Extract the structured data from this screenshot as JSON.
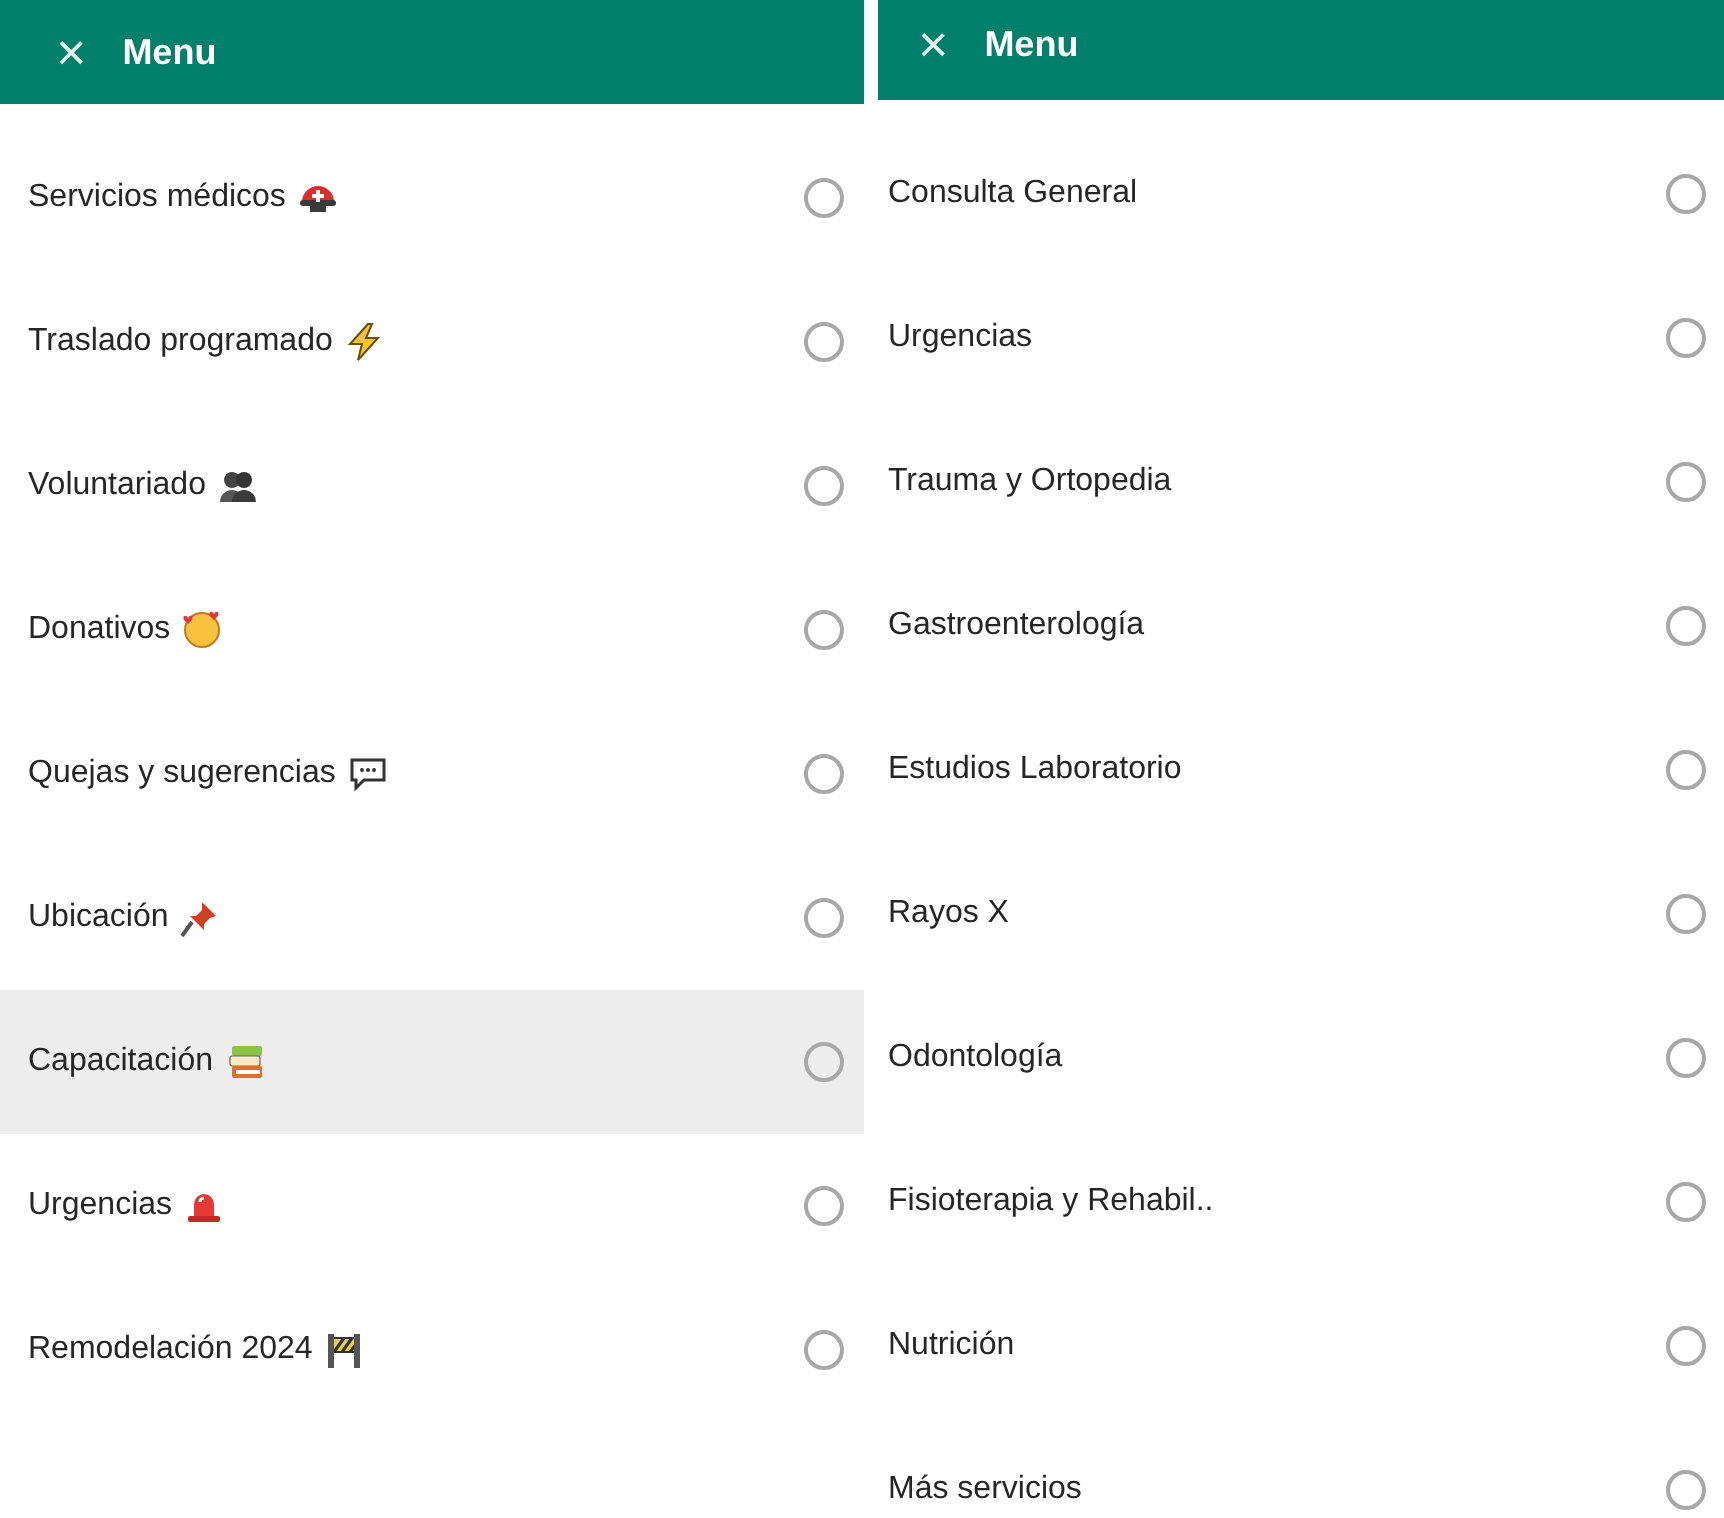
{
  "panels": [
    {
      "header": {
        "close": "×",
        "title": "Menu"
      },
      "items": [
        {
          "label": "Servicios médicos",
          "selected": false,
          "checked": false
        },
        {
          "label": "Traslado programado",
          "selected": false,
          "checked": false
        },
        {
          "label": "Voluntariado",
          "selected": false,
          "checked": false
        },
        {
          "label": "Donativos",
          "selected": false,
          "checked": false
        },
        {
          "label": "Quejas y sugerencias",
          "selected": false,
          "checked": false
        },
        {
          "label": "Ubicación",
          "selected": false,
          "checked": false
        },
        {
          "label": "Capacitación",
          "selected": true,
          "checked": false
        },
        {
          "label": "Urgencias",
          "selected": false,
          "checked": false
        },
        {
          "label": "Remodelación 2024",
          "selected": false,
          "checked": false
        }
      ]
    },
    {
      "header": {
        "close": "×",
        "title": "Menu"
      },
      "items": [
        {
          "label": "Consulta General",
          "selected": false,
          "checked": false
        },
        {
          "label": "Urgencias",
          "selected": false,
          "checked": false
        },
        {
          "label": "Trauma y Ortopedia",
          "selected": false,
          "checked": false
        },
        {
          "label": "Gastroenterología",
          "selected": false,
          "checked": false
        },
        {
          "label": "Estudios Laboratorio",
          "selected": false,
          "checked": false
        },
        {
          "label": "Rayos X",
          "selected": false,
          "checked": false
        },
        {
          "label": "Odontología",
          "selected": false,
          "checked": false
        },
        {
          "label": "Fisioterapia y Rehabil..",
          "selected": false,
          "checked": false
        },
        {
          "label": "Nutrición",
          "selected": false,
          "checked": false
        },
        {
          "label": "Más servicios",
          "selected": false,
          "checked": false
        }
      ]
    }
  ]
}
